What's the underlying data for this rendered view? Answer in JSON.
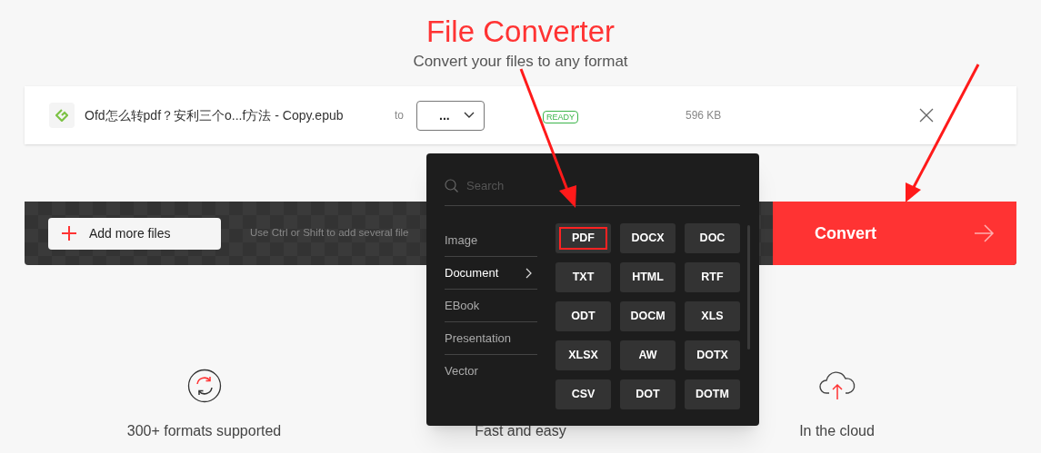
{
  "header": {
    "title": "File Converter",
    "subtitle": "Convert your files to any format"
  },
  "file": {
    "name": "Ofd怎么转pdf？安利三个o...f方法 - Copy.epub",
    "to_label": "to",
    "format_value": "...",
    "status": "READY",
    "size": "596 KB"
  },
  "toolbar": {
    "add_button": "Add more files",
    "hint": "Use Ctrl or Shift to add several file",
    "convert_button": "Convert"
  },
  "format_menu": {
    "search_placeholder": "Search",
    "categories": [
      {
        "label": "Image",
        "selected": false
      },
      {
        "label": "Document",
        "selected": true
      },
      {
        "label": "EBook",
        "selected": false
      },
      {
        "label": "Presentation",
        "selected": false
      },
      {
        "label": "Vector",
        "selected": false
      }
    ],
    "formats": [
      {
        "label": "PDF",
        "highlighted": true
      },
      {
        "label": "DOCX",
        "highlighted": false
      },
      {
        "label": "DOC",
        "highlighted": false
      },
      {
        "label": "TXT",
        "highlighted": false
      },
      {
        "label": "HTML",
        "highlighted": false
      },
      {
        "label": "RTF",
        "highlighted": false
      },
      {
        "label": "ODT",
        "highlighted": false
      },
      {
        "label": "DOCM",
        "highlighted": false
      },
      {
        "label": "XLS",
        "highlighted": false
      },
      {
        "label": "XLSX",
        "highlighted": false
      },
      {
        "label": "AW",
        "highlighted": false
      },
      {
        "label": "DOTX",
        "highlighted": false
      },
      {
        "label": "CSV",
        "highlighted": false
      },
      {
        "label": "DOT",
        "highlighted": false
      },
      {
        "label": "DOTM",
        "highlighted": false
      }
    ]
  },
  "features": [
    {
      "kind": "sync",
      "label": "300+ formats supported"
    },
    {
      "kind": "hidden",
      "label": "Fast and easy"
    },
    {
      "kind": "cloud",
      "label": "In the cloud"
    }
  ]
}
